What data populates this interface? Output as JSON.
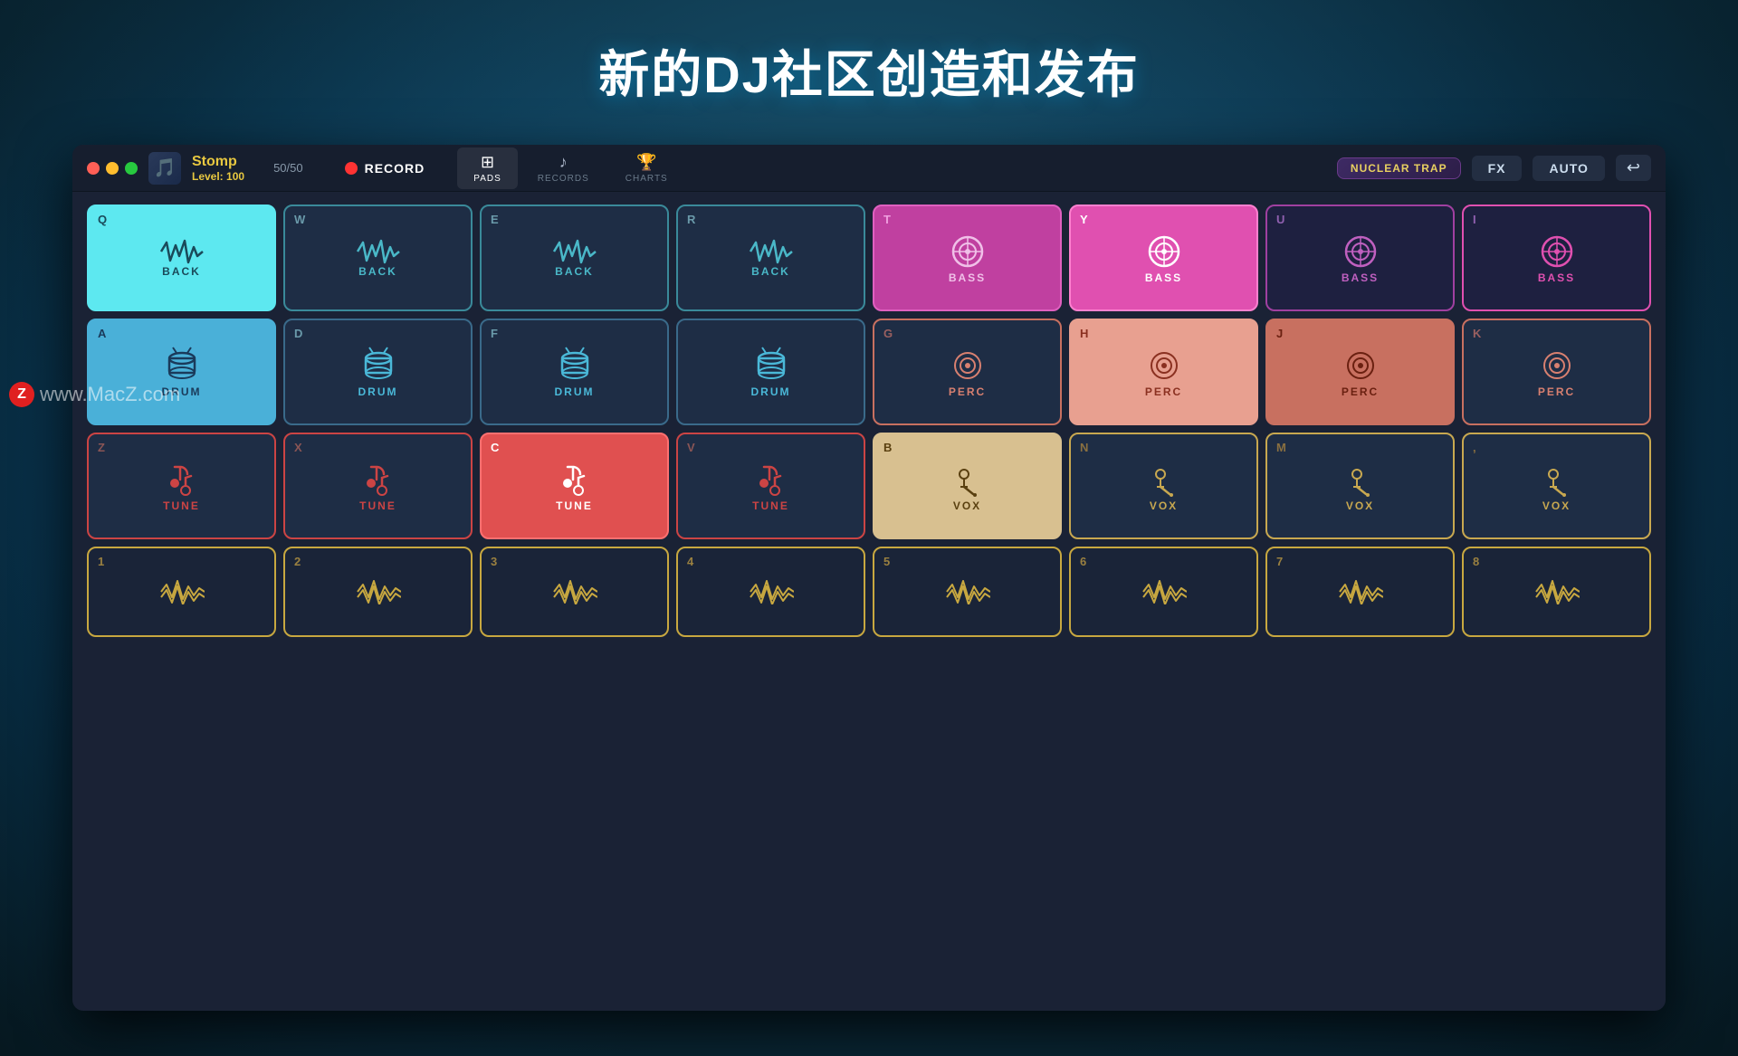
{
  "page": {
    "title": "新的DJ社区创造和发布",
    "watermark": "www.MacZ.com",
    "watermark_z": "Z"
  },
  "titlebar": {
    "app_name": "Stomp",
    "level_label": "Level:",
    "level_value": "100",
    "score": "50/50",
    "record_label": "RECORD",
    "fx_label": "FX",
    "auto_label": "AUTO",
    "preset_label": "NUCLEAR TRAP",
    "tabs": [
      {
        "id": "pads",
        "label": "PADS",
        "active": true
      },
      {
        "id": "records",
        "label": "RECORDS",
        "active": false
      },
      {
        "id": "charts",
        "label": "CHARTS",
        "active": false
      }
    ]
  },
  "pads": {
    "rows": [
      {
        "id": "back-row",
        "pads": [
          {
            "key": "Q",
            "label": "BACK",
            "type": "back-active"
          },
          {
            "key": "W",
            "label": "BACK",
            "type": "back-dark"
          },
          {
            "key": "E",
            "label": "BACK",
            "type": "back-dark"
          },
          {
            "key": "R",
            "label": "BACK",
            "type": "back-dark"
          },
          {
            "key": "T",
            "label": "BASS",
            "type": "bass-pink"
          },
          {
            "key": "Y",
            "label": "BASS",
            "type": "bass-active"
          },
          {
            "key": "U",
            "label": "BASS",
            "type": "bass-dark"
          },
          {
            "key": "I",
            "label": "BASS",
            "type": "bass-outline"
          }
        ]
      },
      {
        "id": "drum-row",
        "pads": [
          {
            "key": "A",
            "label": "DRUM",
            "type": "drum-active"
          },
          {
            "key": "D",
            "label": "DRUM",
            "type": "drum-dark"
          },
          {
            "key": "F",
            "label": "DRUM",
            "type": "drum-dark"
          },
          {
            "key": ".",
            "label": "DRUM",
            "type": "drum-dark"
          },
          {
            "key": "G",
            "label": "PERC",
            "type": "perc-dark"
          },
          {
            "key": "H",
            "label": "PERC",
            "type": "perc-light"
          },
          {
            "key": "J",
            "label": "PERC",
            "type": "perc-med"
          },
          {
            "key": "K",
            "label": "PERC",
            "type": "perc-dark"
          }
        ]
      },
      {
        "id": "tune-row",
        "pads": [
          {
            "key": "Z",
            "label": "TUNE",
            "type": "tune-dark"
          },
          {
            "key": "X",
            "label": "TUNE",
            "type": "tune-dark"
          },
          {
            "key": "C",
            "label": "TUNE",
            "type": "tune-red"
          },
          {
            "key": "V",
            "label": "TUNE",
            "type": "tune-outline"
          },
          {
            "key": "B",
            "label": "VOX",
            "type": "vox-beige"
          },
          {
            "key": "N",
            "label": "VOX",
            "type": "vox-dark"
          },
          {
            "key": "M",
            "label": "VOX",
            "type": "vox-dark"
          },
          {
            "key": ",",
            "label": "VOX",
            "type": "vox-dark"
          }
        ]
      },
      {
        "id": "fx-row",
        "pads": [
          {
            "key": "1",
            "label": "",
            "type": "fx"
          },
          {
            "key": "2",
            "label": "",
            "type": "fx"
          },
          {
            "key": "3",
            "label": "",
            "type": "fx"
          },
          {
            "key": "4",
            "label": "",
            "type": "fx"
          },
          {
            "key": "5",
            "label": "",
            "type": "fx"
          },
          {
            "key": "6",
            "label": "",
            "type": "fx"
          },
          {
            "key": "7",
            "label": "",
            "type": "fx"
          },
          {
            "key": "8",
            "label": "",
            "type": "fx"
          }
        ]
      }
    ]
  }
}
